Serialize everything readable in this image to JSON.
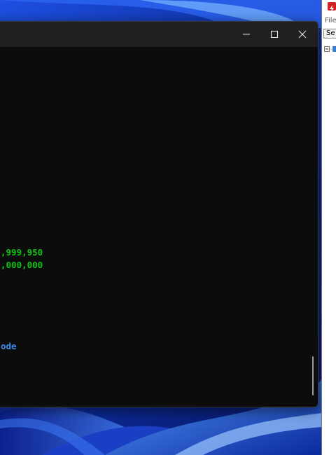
{
  "terminal": {
    "output_lines": [
      ",999,950",
      ",000,000",
      "ode"
    ],
    "controls": {
      "minimize_icon": "minimize-icon",
      "maximize_icon": "maximize-icon",
      "close_icon": "close-icon"
    },
    "colors": {
      "background": "#0c0c0c",
      "titlebar": "#202020",
      "green_text": "#13c313",
      "blue_text": "#3b8eea"
    }
  },
  "side_app": {
    "menu_label": "File",
    "column_header": "Se",
    "icon": "app-icon"
  }
}
